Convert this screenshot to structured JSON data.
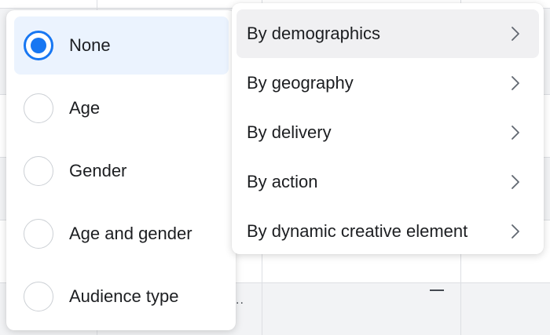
{
  "background": {
    "cell_placeholder": "–",
    "truncated_text": ".."
  },
  "breakdown_options": {
    "selected_index": 0,
    "items": [
      {
        "label": "None"
      },
      {
        "label": "Age"
      },
      {
        "label": "Gender"
      },
      {
        "label": "Age and gender"
      },
      {
        "label": "Audience type"
      }
    ]
  },
  "breakdown_categories": {
    "hovered_index": 0,
    "items": [
      {
        "label": "By demographics",
        "icon": "chevron-right-icon"
      },
      {
        "label": "By geography",
        "icon": "chevron-right-icon"
      },
      {
        "label": "By delivery",
        "icon": "chevron-right-icon"
      },
      {
        "label": "By action",
        "icon": "chevron-right-icon"
      },
      {
        "label": "By dynamic creative element",
        "icon": "chevron-right-icon"
      }
    ]
  },
  "colors": {
    "accent": "#1877f2",
    "selected_row_bg": "#ebf3fe",
    "hover_row_bg": "#f0f0f2"
  }
}
